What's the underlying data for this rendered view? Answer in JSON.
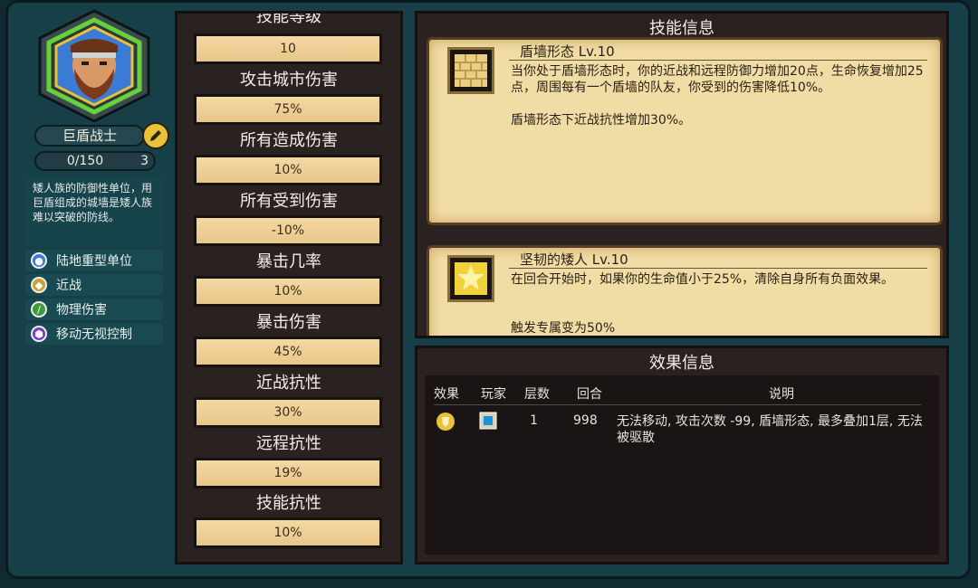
{
  "hero": {
    "name": "巨盾战士",
    "xp": "0/150",
    "level": "3",
    "description": "矮人族的防御性单位，用巨盾组成的城墙是矮人族难以突破的防线。",
    "tags": [
      {
        "label": "陆地重型单位",
        "icon": "person-icon",
        "color": "#3b7bd6"
      },
      {
        "label": "近战",
        "icon": "melee-icon",
        "color": "#c9a33a"
      },
      {
        "label": "物理伤害",
        "icon": "sword-icon",
        "color": "#3e9a3a"
      },
      {
        "label": "移动无视控制",
        "icon": "hexagon-icon",
        "color": "#7a3bc9"
      }
    ]
  },
  "stats": [
    {
      "label": "技能等级",
      "value": "10"
    },
    {
      "label": "攻击城市伤害",
      "value": "75%"
    },
    {
      "label": "所有造成伤害",
      "value": "10%"
    },
    {
      "label": "所有受到伤害",
      "value": "-10%"
    },
    {
      "label": "暴击几率",
      "value": "10%"
    },
    {
      "label": "暴击伤害",
      "value": "45%"
    },
    {
      "label": "近战抗性",
      "value": "30%"
    },
    {
      "label": "远程抗性",
      "value": "19%"
    },
    {
      "label": "技能抗性",
      "value": "10%"
    }
  ],
  "skills": {
    "title": "技能信息",
    "items": [
      {
        "name": "盾墙形态 Lv.10",
        "desc1": "当你处于盾墙形态时，你的近战和远程防御力增加20点，生命恢复增加25点，周围每有一个盾墙的队友，你受到的伤害降低10%。",
        "desc2": "盾墙形态下近战抗性增加30%。"
      },
      {
        "name": "坚韧的矮人 Lv.10",
        "desc1": "在回合开始时，如果你的生命值小于25%，清除自身所有负面效果。",
        "desc2": "触发专属变为50%"
      }
    ]
  },
  "effects": {
    "title": "效果信息",
    "headers": [
      "效果",
      "玩家",
      "层数",
      "回合",
      "说明"
    ],
    "rows": [
      {
        "stacks": "1",
        "turns": "998",
        "note": "无法移动, 攻击次数 -99, 盾墙形态, 最多叠加1层, 无法被驱散"
      }
    ]
  }
}
